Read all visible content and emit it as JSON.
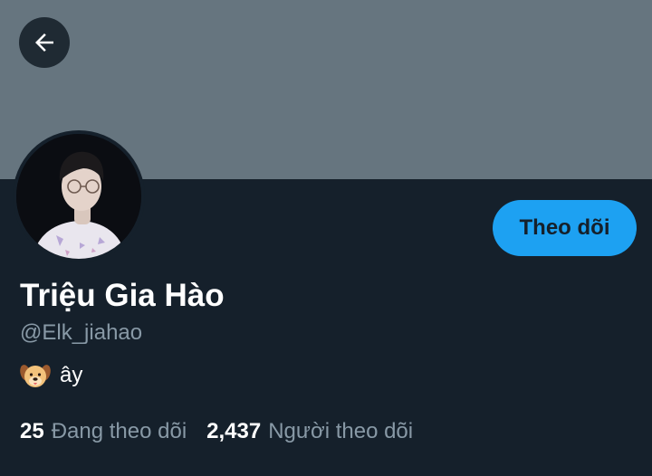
{
  "profile": {
    "display_name": "Triệu Gia Hào",
    "handle": "@Elk_jiahao",
    "bio_text": "ây",
    "bio_emoji": "dog-face-icon"
  },
  "actions": {
    "follow_label": "Theo dõi"
  },
  "stats": {
    "following_count": "25",
    "following_label": "Đang theo dõi",
    "followers_count": "2,437",
    "followers_label": "Người theo dõi"
  },
  "icons": {
    "back": "arrow-left-icon"
  },
  "colors": {
    "background": "#15202b",
    "banner": "#66757f",
    "accent": "#1da1f2",
    "muted_text": "#8899a6"
  }
}
